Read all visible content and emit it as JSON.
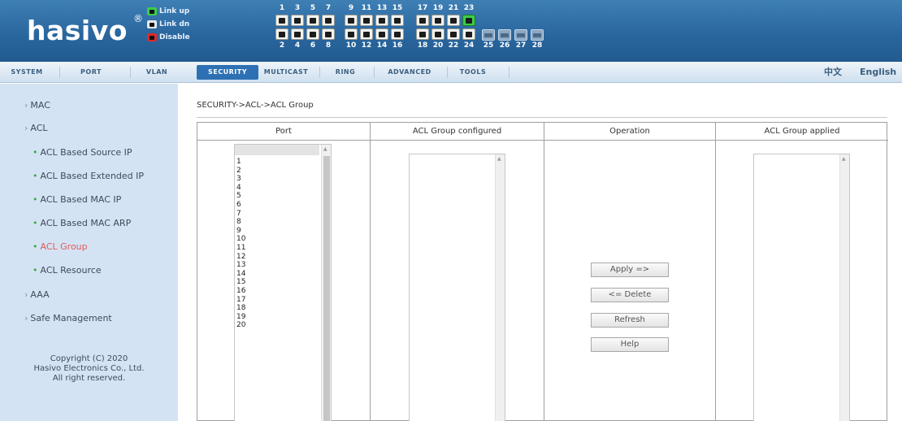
{
  "header": {
    "logo_text": "hasivo",
    "logo_reg": "®",
    "legend": [
      {
        "label": "Link up",
        "color": "#3dcc4a"
      },
      {
        "label": "Link dn",
        "color": "#e8e8e8"
      },
      {
        "label": "Disable",
        "color": "#e02828"
      }
    ],
    "ports_top_labels": [
      "1",
      "3",
      "5",
      "7",
      "9",
      "11",
      "13",
      "15",
      "17",
      "19",
      "21",
      "23"
    ],
    "ports_bottom_labels": [
      "2",
      "4",
      "6",
      "8",
      "10",
      "12",
      "14",
      "16",
      "18",
      "20",
      "22",
      "24"
    ],
    "ports_up": [
      "23"
    ],
    "sfp_labels": [
      "25",
      "26",
      "27",
      "28"
    ]
  },
  "nav": {
    "items": [
      "SYSTEM",
      "PORT",
      "VLAN",
      "SECURITY",
      "MULTICAST",
      "RING",
      "ADVANCED",
      "TOOLS"
    ],
    "active": "SECURITY",
    "lang_cn": "中文",
    "lang_en": "English"
  },
  "sidebar": {
    "items": [
      {
        "label": "MAC",
        "level": 0
      },
      {
        "label": "ACL",
        "level": 0
      },
      {
        "label": "ACL Based Source IP",
        "level": 1
      },
      {
        "label": "ACL Based Extended IP",
        "level": 1
      },
      {
        "label": "ACL Based MAC IP",
        "level": 1
      },
      {
        "label": "ACL Based MAC ARP",
        "level": 1
      },
      {
        "label": "ACL Group",
        "level": 1,
        "active": true
      },
      {
        "label": "ACL Resource",
        "level": 1
      },
      {
        "label": "AAA",
        "level": 0
      },
      {
        "label": "Safe Management",
        "level": 0
      }
    ],
    "copyright": [
      "Copyright (C) 2020",
      "Hasivo Electronics Co., Ltd.",
      "All right reserved."
    ]
  },
  "main": {
    "breadcrumb": "SECURITY->ACL->ACL Group",
    "columns": [
      "Port",
      "ACL Group configured",
      "Operation",
      "ACL Group applied"
    ],
    "port_options": [
      "1",
      "2",
      "3",
      "4",
      "5",
      "6",
      "7",
      "8",
      "9",
      "10",
      "11",
      "12",
      "13",
      "14",
      "15",
      "16",
      "17",
      "18",
      "19",
      "20"
    ],
    "buttons": {
      "apply": "Apply =>",
      "delete": "<= Delete",
      "refresh": "Refresh",
      "help": "Help"
    }
  }
}
